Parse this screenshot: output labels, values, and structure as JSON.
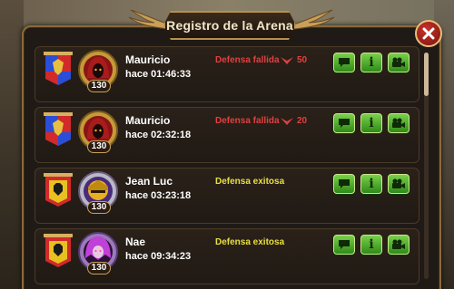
{
  "window": {
    "title": "Registro de la Arena"
  },
  "entries": [
    {
      "name": "Mauricio",
      "time": "hace 01:46:33",
      "level": "130",
      "result": "Defensa fallida",
      "result_kind": "fail",
      "delta": "50",
      "banner": "blue-red-eagle",
      "avatar": "hooded-reaper"
    },
    {
      "name": "Mauricio",
      "time": "hace 02:32:18",
      "level": "130",
      "result": "Defensa fallida",
      "result_kind": "fail",
      "delta": "20",
      "banner": "blue-red-eagle",
      "avatar": "hooded-reaper"
    },
    {
      "name": "Jean Luc",
      "time": "hace 03:23:18",
      "level": "130",
      "result": "Defensa exitosa",
      "result_kind": "win",
      "delta": "",
      "banner": "red-yellow-black-beast",
      "avatar": "golden-knight"
    },
    {
      "name": "Nae",
      "time": "hace 09:34:23",
      "level": "130",
      "result": "Defensa exitosa",
      "result_kind": "win",
      "delta": "",
      "banner": "red-yellow-black-beast",
      "avatar": "purple-haired-witch"
    }
  ],
  "buttons": {
    "chat_icon": "chat-bubble-icon",
    "info_icon": "info-icon",
    "info_glyph": "i",
    "video_icon": "video-camera-icon"
  },
  "colors": {
    "fail": "#e04040",
    "win": "#e8e040",
    "button_green": "#4cae2a",
    "frame_gold": "#b8904a"
  },
  "scroll": {
    "position_fraction": 0.0
  }
}
